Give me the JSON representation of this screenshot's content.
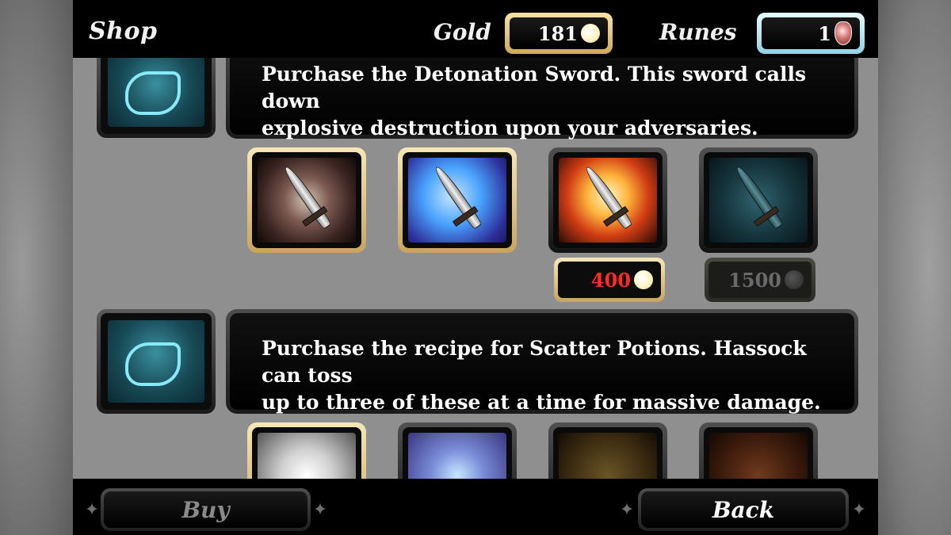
{
  "topbar": {
    "title": "Shop",
    "gold_label": "Gold",
    "gold_value": "181",
    "runes_label": "Runes",
    "runes_value": "1"
  },
  "sections": [
    {
      "icon": "sword-grip-icon",
      "description_line1": "Purchase the Detonation Sword. This sword calls down",
      "description_line2": "explosive destruction upon your adversaries.",
      "items": [
        {
          "icon": "curved-sword-icon",
          "state": "owned"
        },
        {
          "icon": "lightning-sword-icon",
          "state": "owned"
        },
        {
          "icon": "detonation-sword-icon",
          "state": "available",
          "price": "400"
        },
        {
          "icon": "locked-sword-icon",
          "state": "locked",
          "price": "1500"
        }
      ]
    },
    {
      "icon": "throwing-hand-icon",
      "description_line1": "Purchase the recipe for Scatter Potions. Hassock can toss",
      "description_line2": "up to three of these at a time for massive damage.",
      "items": [
        {
          "icon": "potion-bottle-icon",
          "state": "owned"
        },
        {
          "icon": "scatter-potion-icon",
          "state": "owned"
        },
        {
          "icon": "amber-potion-icon",
          "state": "locked"
        },
        {
          "icon": "red-potion-icon",
          "state": "locked"
        }
      ]
    }
  ],
  "bottombar": {
    "buy_label": "Buy",
    "back_label": "Back"
  },
  "colors": {
    "gold_border": "#e0c07a",
    "rune_border": "#b8eaf4",
    "price_active": "#ff2a2a",
    "price_locked": "#6a6a6a"
  }
}
